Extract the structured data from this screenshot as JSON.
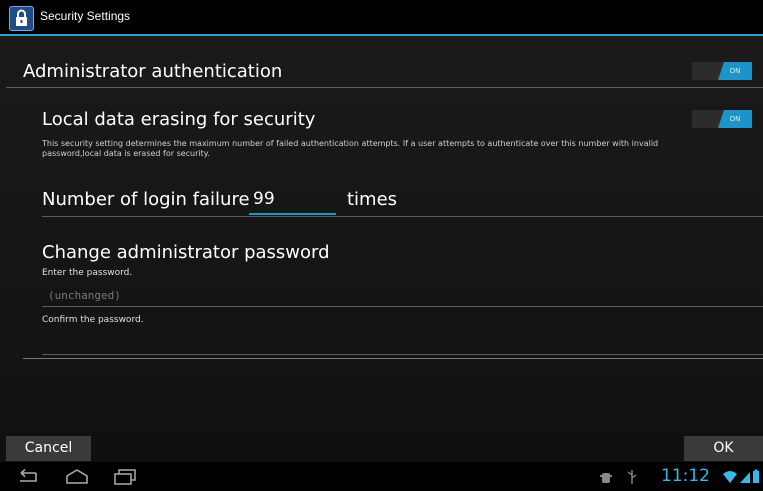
{
  "window": {
    "title": "Security Settings"
  },
  "admin_auth": {
    "label": "Administrator authentication",
    "toggle": "ON"
  },
  "local_erase": {
    "label": "Local data erasing for security",
    "toggle": "ON",
    "description_line1": "This security setting determines the maximum number of failed authentication attempts.    If a user attempts to authenticate over this number with invalid",
    "description_line2": "password,local data is erased for security."
  },
  "login_failure": {
    "label": "Number of login failure",
    "value": "99",
    "unit": "times"
  },
  "change_password": {
    "label": "Change administrator password",
    "enter_label": "Enter the password.",
    "enter_placeholder": "(unchanged)",
    "confirm_label": "Confirm the password.",
    "confirm_placeholder": ""
  },
  "buttons": {
    "cancel": "Cancel",
    "ok": "OK"
  },
  "status": {
    "time": "11:12"
  },
  "colors": {
    "accent": "#1d93c7",
    "title_divider": "#2f9ec9",
    "clock": "#39b7ea"
  },
  "icons": [
    "lock-icon",
    "back-icon",
    "home-icon",
    "recent-apps-icon",
    "debug-icon",
    "usb-icon",
    "wifi-icon",
    "signal-icon",
    "battery-icon"
  ]
}
